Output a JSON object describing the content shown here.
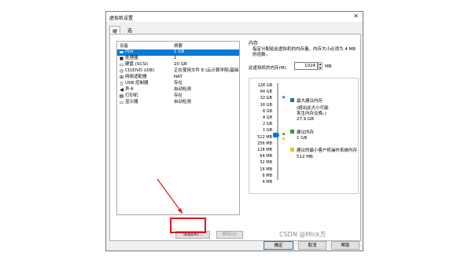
{
  "window": {
    "title": "虚拟机设置",
    "close_glyph": "✕"
  },
  "tabs": [
    {
      "label": "硬件"
    },
    {
      "label": "选项"
    }
  ],
  "device_table": {
    "headers": {
      "device": "设备",
      "summary": "摘要"
    },
    "rows": [
      {
        "device": "内存",
        "summary": "1 GB",
        "icon": "memory-icon",
        "glyph": "▬",
        "selected": true
      },
      {
        "device": "处理器",
        "summary": "1",
        "icon": "processor-icon",
        "glyph": "▣",
        "selected": false
      },
      {
        "device": "硬盘 (SCSI)",
        "summary": "20 GB",
        "icon": "hard-disk-icon",
        "glyph": "▭",
        "selected": false
      },
      {
        "device": "CD/DVD (IDE)",
        "summary": "正在使用文件 E:\\云计算学院\\基础",
        "icon": "cd-icon",
        "glyph": "◎",
        "selected": false
      },
      {
        "device": "网络适配器",
        "summary": "NAT",
        "icon": "network-icon",
        "glyph": "⊞",
        "selected": false
      },
      {
        "device": "USB 控制器",
        "summary": "存在",
        "icon": "usb-icon",
        "glyph": "▯",
        "selected": false
      },
      {
        "device": "声卡",
        "summary": "自动检测",
        "icon": "sound-icon",
        "glyph": "◀",
        "selected": false
      },
      {
        "device": "打印机",
        "summary": "存在",
        "icon": "printer-icon",
        "glyph": "▤",
        "selected": false
      },
      {
        "device": "显示器",
        "summary": "自动检测",
        "icon": "monitor-icon",
        "glyph": "▭",
        "selected": false
      }
    ]
  },
  "buttons": {
    "add": "添加(A)...",
    "remove": "移除(R)"
  },
  "memory": {
    "section_title": "内存",
    "description": "指定分配给此虚拟机的内存量。内存大小必须为 4 MB 的倍数。",
    "field_label": "此虚拟机的内存(M):",
    "value": "1024",
    "unit": "MB",
    "scale": [
      "128 GB",
      "64 GB",
      "32 GB",
      "16 GB",
      "8 GB",
      "4 GB",
      "2 GB",
      "1 GB",
      "512 MB",
      "256 MB",
      "128 MB",
      "64 MB",
      "32 MB",
      "16 MB",
      "8 MB",
      "4 MB"
    ],
    "legend": {
      "max_label": "最大建议内存",
      "max_note_1": "(超出此大小可能",
      "max_note_2": "发生内存交换。)",
      "max_value": "27.9 GB",
      "rec_label": "建议内存",
      "rec_value": "1 GB",
      "min_label": "建议的最小客户机操作系统内存",
      "min_value": "512 MB"
    },
    "colors": {
      "max": "#1a6fc0",
      "rec": "#2e9a2e",
      "min": "#e8c51c",
      "slider": "#0a78d7"
    }
  },
  "footer": {
    "ok": "确定",
    "cancel": "取消",
    "help": "帮助"
  },
  "watermark": "CSDN @Mick方",
  "annotation_color": "#e0141e"
}
